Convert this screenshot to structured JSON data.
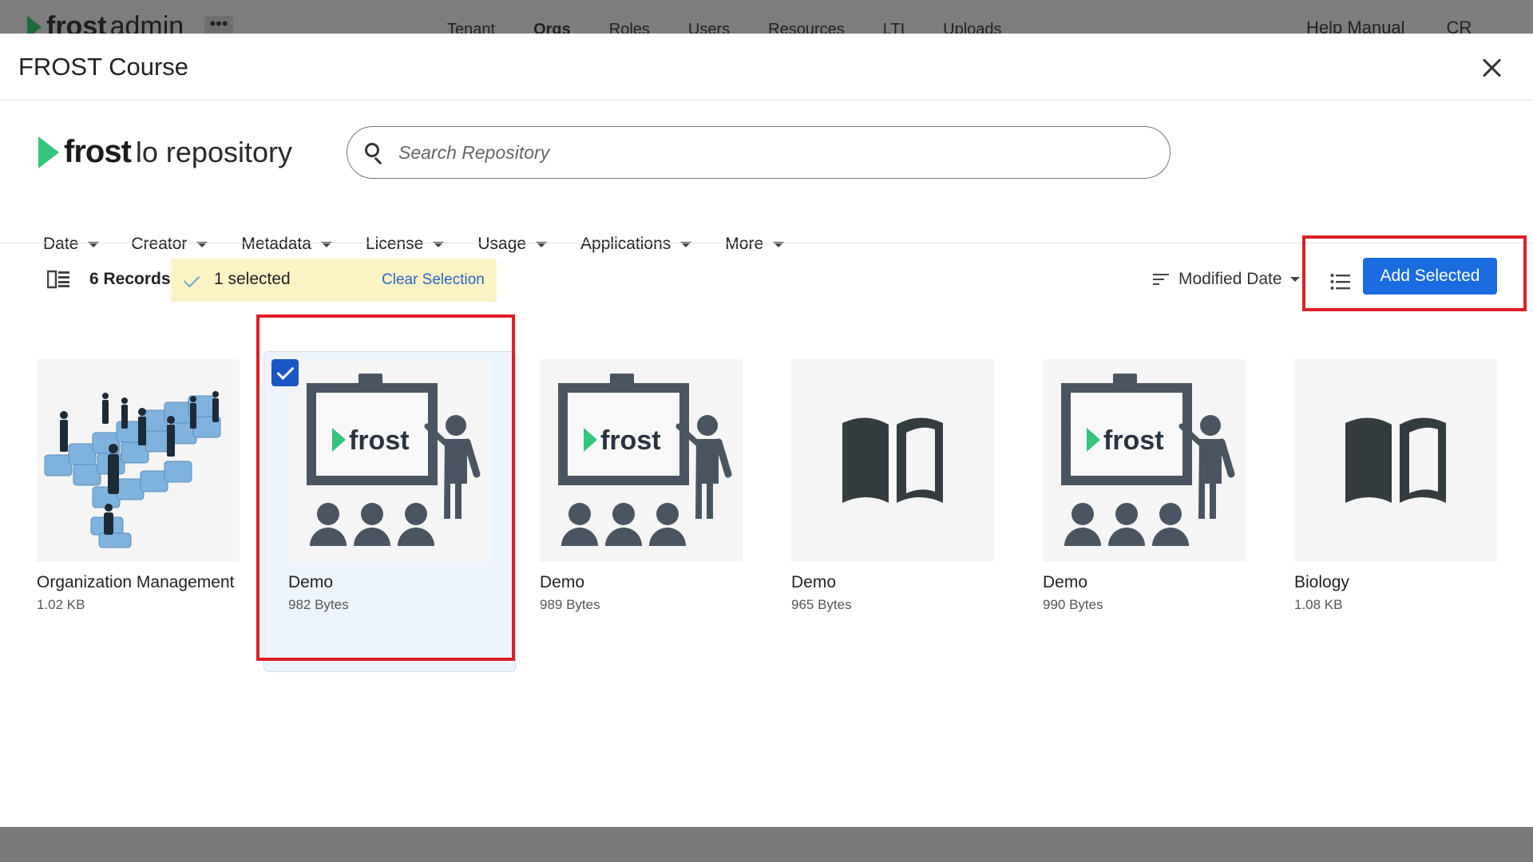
{
  "background_nav": {
    "logo_text": "frost",
    "logo_suffix": "admin",
    "links": [
      {
        "label": "Tenant",
        "active": false
      },
      {
        "label": "Orgs",
        "active": true
      },
      {
        "label": "Roles",
        "active": false
      },
      {
        "label": "Users",
        "active": false
      },
      {
        "label": "Resources",
        "active": false
      },
      {
        "label": "LTI",
        "active": false
      },
      {
        "label": "Uploads",
        "active": false
      }
    ],
    "help_label": "Help Manual",
    "user_initials": "CR"
  },
  "modal": {
    "title": "FROST Course",
    "close_icon": "close-icon"
  },
  "repository": {
    "brand": "frost",
    "subtitle": "lo repository",
    "brand_color": "#33c57d"
  },
  "search": {
    "placeholder": "Search Repository",
    "value": ""
  },
  "filters": [
    "Date",
    "Creator",
    "Metadata",
    "License",
    "Usage",
    "Applications",
    "More"
  ],
  "toolbar": {
    "records_count": "6 Records",
    "selected_text": "1 selected",
    "clear_label": "Clear Selection",
    "sort_label": "Modified Date",
    "add_label": "Add Selected",
    "accent_color": "#1a6ce0"
  },
  "items": [
    {
      "name": "Organization Management",
      "size": "1.02 KB",
      "thumb": "people-puzzle-image",
      "selected": false
    },
    {
      "name": "Demo",
      "size": "982 Bytes",
      "thumb": "presentation-icon",
      "selected": true
    },
    {
      "name": "Demo",
      "size": "989 Bytes",
      "thumb": "presentation-icon",
      "selected": false
    },
    {
      "name": "Demo",
      "size": "965 Bytes",
      "thumb": "book-icon",
      "selected": false
    },
    {
      "name": "Demo",
      "size": "990 Bytes",
      "thumb": "presentation-icon",
      "selected": false
    },
    {
      "name": "Biology",
      "size": "1.08 KB",
      "thumb": "book-icon",
      "selected": false
    }
  ],
  "presentation_board_text": "frost"
}
